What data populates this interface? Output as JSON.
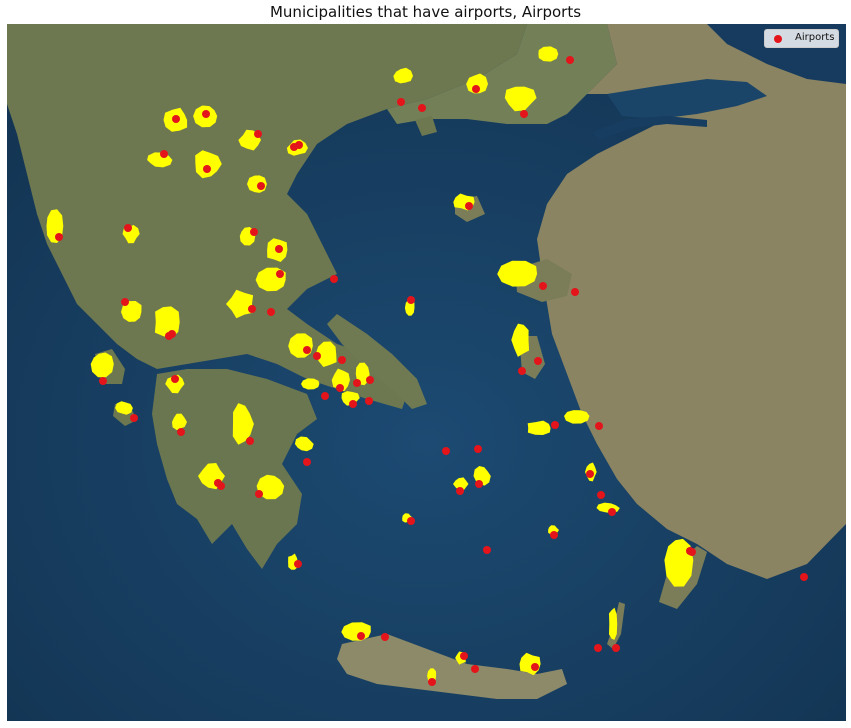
{
  "title": "Municipalities that have airports, Airports",
  "legend": {
    "label": "Airports"
  },
  "colors": {
    "sea": "#173d61",
    "land": "#6f7a52",
    "land_dry": "#9a9273",
    "mountain": "#5e6447",
    "highlight": "#ffff00",
    "marker": "#e4141b"
  },
  "icons": {
    "marker": "red-circle-marker-icon"
  }
}
